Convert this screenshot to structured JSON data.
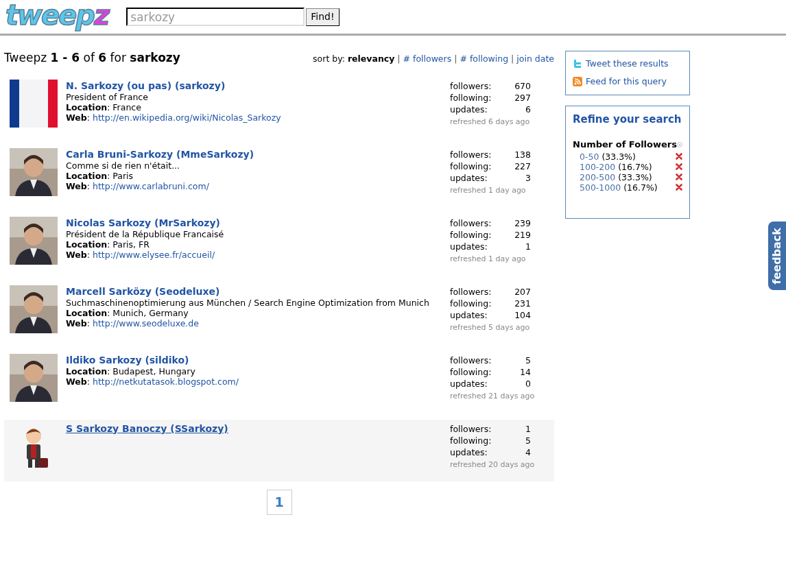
{
  "logo": {
    "text_main": "tweep",
    "text_accent": "z"
  },
  "search": {
    "value": "sarkozy",
    "button": "Find!"
  },
  "summary": "Tweepz **1 - 6** of **6** for **sarkozy**",
  "sort": {
    "label": "sort by:",
    "options": [
      {
        "label": "relevancy",
        "selected": true
      },
      {
        "sep": "|",
        "label": "# followers",
        "selected": false
      },
      {
        "sep": "|",
        "label": "# following",
        "selected": false
      },
      {
        "sep": "|",
        "label": "join date",
        "selected": false
      }
    ]
  },
  "results": [
    {
      "avatar": {
        "kind": "flag"
      },
      "name": "N. Sarkozy (ou pas) (sarkozy)",
      "bio": "President of France",
      "location": "**Location**: France",
      "web_label": "**Web**:",
      "web": "http://en.wikipedia.org/wiki/Nicolas_Sarkozy",
      "stats": [
        {
          "label": "followers:",
          "value": "670"
        },
        {
          "label": "following:",
          "value": "297"
        },
        {
          "label": "updates:",
          "value": "6"
        }
      ],
      "refreshed": "refreshed 6 days ago",
      "highlighted": false
    },
    {
      "avatar": {
        "kind": "picture"
      },
      "name": "Carla Bruni-Sarkozy (MmeSarkozy)",
      "bio": "Comme si de rien n'était...",
      "location": "**Location**: Paris",
      "web_label": "**Web**:",
      "web": "http://www.carlabruni.com/",
      "stats": [
        {
          "label": "followers:",
          "value": "138"
        },
        {
          "label": "following:",
          "value": "227"
        },
        {
          "label": "updates:",
          "value": "3"
        }
      ],
      "refreshed": "refreshed 1 day ago",
      "highlighted": false
    },
    {
      "avatar": {
        "kind": "picture"
      },
      "name": "Nicolas Sarkozy (MrSarkozy)",
      "bio": "Président de la République Francaisé",
      "location": "**Location**: Paris, FR",
      "web_label": "**Web**:",
      "web": "http://www.elysee.fr/accueil/",
      "stats": [
        {
          "label": "followers:",
          "value": "239"
        },
        {
          "label": "following:",
          "value": "219"
        },
        {
          "label": "updates:",
          "value": "1"
        }
      ],
      "refreshed": "refreshed 1 day ago",
      "highlighted": false
    },
    {
      "avatar": {
        "kind": "picture"
      },
      "name": "Marcell Sarközy (Seodeluxe)",
      "bio": "Suchmaschinenoptimierung aus München / Search Engine Optimization from Munich",
      "location": "**Location**: Munich, Germany",
      "web_label": "**Web**:",
      "web": "http://www.seodeluxe.de",
      "stats": [
        {
          "label": "followers:",
          "value": "207"
        },
        {
          "label": "following:",
          "value": "231"
        },
        {
          "label": "updates:",
          "value": "104"
        }
      ],
      "refreshed": "refreshed 5 days ago",
      "highlighted": false
    },
    {
      "avatar": {
        "kind": "picture"
      },
      "name": "Ildiko Sarkozy (sildiko)",
      "location": "**Location**: Budapest, Hungary",
      "web_label": "**Web**:",
      "web": "http://netkutatasok.blogspot.com/",
      "stats": [
        {
          "label": "followers:",
          "value": "5"
        },
        {
          "label": "following:",
          "value": "14"
        },
        {
          "label": "updates:",
          "value": "0"
        }
      ],
      "refreshed": "refreshed 21 days ago",
      "highlighted": false
    },
    {
      "avatar": {
        "kind": "cartoon"
      },
      "name": "S Sarkozy Banoczy (SSarkozy)",
      "stats": [
        {
          "label": "followers:",
          "value": "1"
        },
        {
          "label": "following:",
          "value": "5"
        },
        {
          "label": "updates:",
          "value": "4"
        }
      ],
      "refreshed": "refreshed 20 days ago",
      "highlighted": true
    }
  ],
  "pagination": [
    {
      "label": "1",
      "selected": true
    }
  ],
  "share": {
    "tweet": "Tweet these results",
    "feed": "Feed for this query"
  },
  "refine": {
    "title": "Refine your search",
    "section": "Number of Followers",
    "facets": [
      {
        "range": "0-50",
        "share": "(33.3%)"
      },
      {
        "range": "100-200",
        "share": "(16.7%)"
      },
      {
        "range": "200-500",
        "share": "(33.3%)"
      },
      {
        "range": "500-1000",
        "share": "(16.7%)"
      }
    ]
  },
  "feedback_tab": "feedback"
}
